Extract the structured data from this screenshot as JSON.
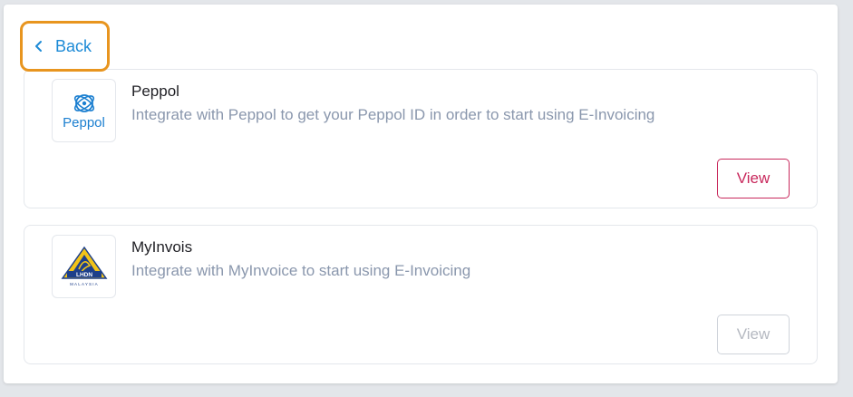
{
  "back": {
    "label": "Back"
  },
  "integrations": [
    {
      "name": "Peppol",
      "description": "Integrate with Peppol to get your Peppol ID in order to start using E-Invoicing",
      "logo_text": "Peppol",
      "view_label": "View",
      "view_enabled": true
    },
    {
      "name": "MyInvois",
      "description": "Integrate with MyInvoice to start using E-Invoicing",
      "logo_text": "LHDN",
      "logo_subtext": "MALAYSIA",
      "view_label": "View",
      "view_enabled": false
    }
  ],
  "colors": {
    "accent": "#1c8ad6",
    "focus_ring": "#e8951f",
    "view_active": "#c8285c",
    "view_disabled": "#b5b9c1",
    "description_text": "#8a97ad"
  },
  "icons": {
    "back": "chevron-left-icon",
    "peppol_logo": "peppol-logo",
    "myinvois_logo": "lhdn-logo"
  }
}
